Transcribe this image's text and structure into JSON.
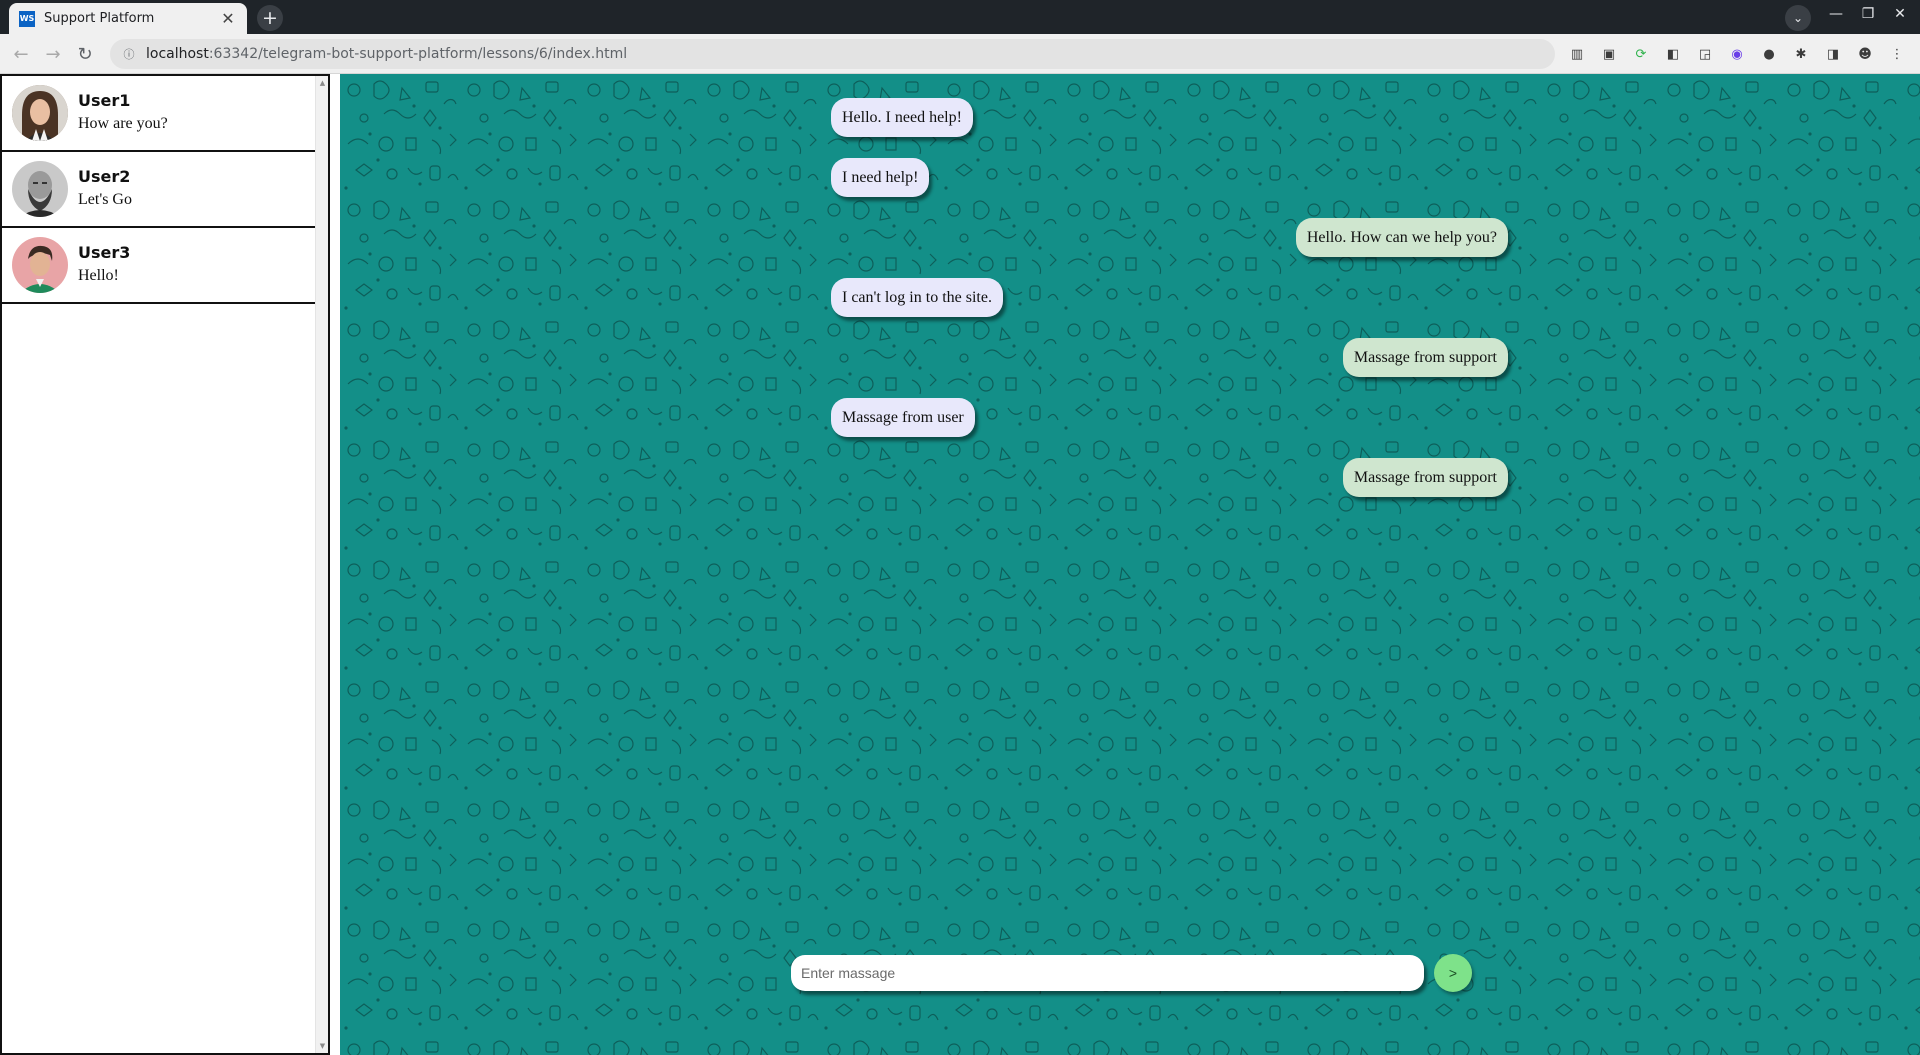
{
  "browser": {
    "tab_title": "Support Platform",
    "tab_favicon": "WS",
    "tab_close": "✕",
    "new_tab": "+",
    "url_host": "localhost",
    "url_path": ":63342/telegram-bot-support-platform/lessons/6/index.html",
    "window_controls": [
      "—",
      "❐",
      "✕"
    ]
  },
  "contacts": [
    {
      "name": "User1",
      "last_message": "How are you?"
    },
    {
      "name": "User2",
      "last_message": "Let's Go"
    },
    {
      "name": "User3",
      "last_message": "Hello!"
    }
  ],
  "messages": [
    {
      "from": "user",
      "text": "Hello. I need help!"
    },
    {
      "from": "user",
      "text": "I need help!"
    },
    {
      "from": "support",
      "text": "Hello. How can we help you?"
    },
    {
      "from": "user",
      "text": "I can't log in to the site."
    },
    {
      "from": "support",
      "text": "Massage from support"
    },
    {
      "from": "user",
      "text": "Massage from user"
    },
    {
      "from": "support",
      "text": "Massage from support"
    }
  ],
  "composer": {
    "placeholder": "Enter massage",
    "send_label": ">"
  },
  "colors": {
    "chat_background": "#138f88",
    "user_bubble": "#e8e8fb",
    "support_bubble": "#cfe6cf",
    "send_button": "#7ee28a"
  }
}
